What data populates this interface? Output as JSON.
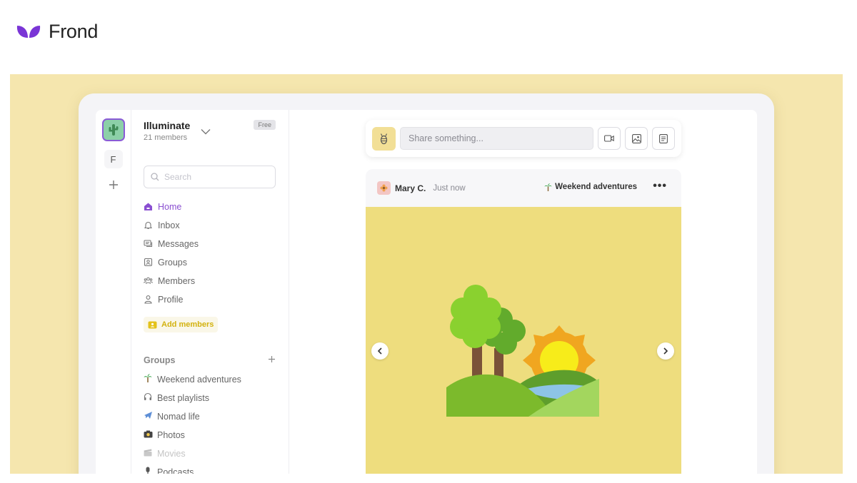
{
  "brand": {
    "name": "Frond"
  },
  "workspace": {
    "name": "Illuminate",
    "members": "21 members",
    "plan_badge": "Free",
    "rail_letter": "F"
  },
  "search": {
    "placeholder": "Search"
  },
  "nav": {
    "items": [
      {
        "label": "Home",
        "icon": "home-icon",
        "active": true
      },
      {
        "label": "Inbox",
        "icon": "bell-icon"
      },
      {
        "label": "Messages",
        "icon": "chat-icon"
      },
      {
        "label": "Groups",
        "icon": "groups-icon"
      },
      {
        "label": "Members",
        "icon": "members-icon"
      },
      {
        "label": "Profile",
        "icon": "profile-icon"
      }
    ]
  },
  "add_members_label": "Add members",
  "groups": {
    "heading": "Groups",
    "items": [
      {
        "label": "Weekend adventures",
        "icon": "palm-tree-icon",
        "glyph": "🌴"
      },
      {
        "label": "Best playlists",
        "icon": "headphones-icon",
        "glyph": "🎧"
      },
      {
        "label": "Nomad life",
        "icon": "airplane-icon",
        "glyph": "✈"
      },
      {
        "label": "Photos",
        "icon": "camera-icon",
        "glyph": "📸"
      },
      {
        "label": "Movies",
        "icon": "film-icon",
        "glyph": "🎬"
      },
      {
        "label": "Podcasts",
        "icon": "microphone-icon",
        "glyph": "🎙"
      }
    ]
  },
  "composer": {
    "placeholder": "Share something..."
  },
  "post": {
    "author": "Mary C.",
    "time": "Just now",
    "group": "Weekend adventures",
    "more": "•••"
  },
  "colors": {
    "accent": "#8a4fd1",
    "hero_bg": "#f5e6ae",
    "image_bg": "#eedd7e",
    "add_members": "#d3b20f"
  }
}
